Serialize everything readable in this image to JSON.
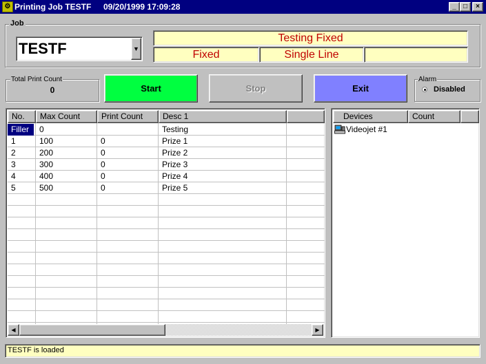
{
  "window": {
    "title": "Printing Job TESTF",
    "datetime": "09/20/1999 17:09:28",
    "icon": "printer-app-icon",
    "controls": {
      "minimize": "_",
      "maximize": "□",
      "close": "×"
    }
  },
  "job": {
    "group_label": "Job",
    "selected": "TESTF",
    "dropdown_glyph": "▼",
    "info": {
      "title": "Testing Fixed",
      "mode": "Fixed",
      "line": "Single Line",
      "extra": ""
    }
  },
  "counters": {
    "total_label": "Total Print Count",
    "total_value": "0"
  },
  "buttons": {
    "start": "Start",
    "stop": "Stop",
    "exit": "Exit"
  },
  "alarm": {
    "label": "Alarm",
    "status": "Disabled"
  },
  "grid": {
    "columns": [
      "No.",
      "Max Count",
      "Print Count",
      "Desc 1",
      ""
    ],
    "rows": [
      [
        "Filler",
        "0",
        "",
        "Testing"
      ],
      [
        "1",
        "100",
        "0",
        "Prize 1"
      ],
      [
        "2",
        "200",
        "0",
        "Prize 2"
      ],
      [
        "3",
        "300",
        "0",
        "Prize 3"
      ],
      [
        "4",
        "400",
        "0",
        "Prize 4"
      ],
      [
        "5",
        "500",
        "0",
        "Prize 5"
      ]
    ]
  },
  "devices": {
    "columns": [
      "Devices",
      "Count",
      ""
    ],
    "items": [
      {
        "name": "Videojet #1",
        "count": "",
        "icon": "printer-device-icon"
      }
    ]
  },
  "status": {
    "text": "TESTF is loaded"
  },
  "colors": {
    "titlebar": "#000080",
    "start_button": "#00ff40",
    "exit_button": "#8080ff",
    "info_field_bg": "#ffffc0",
    "info_field_text": "#c00000",
    "status_bg": "#ffffc0"
  }
}
